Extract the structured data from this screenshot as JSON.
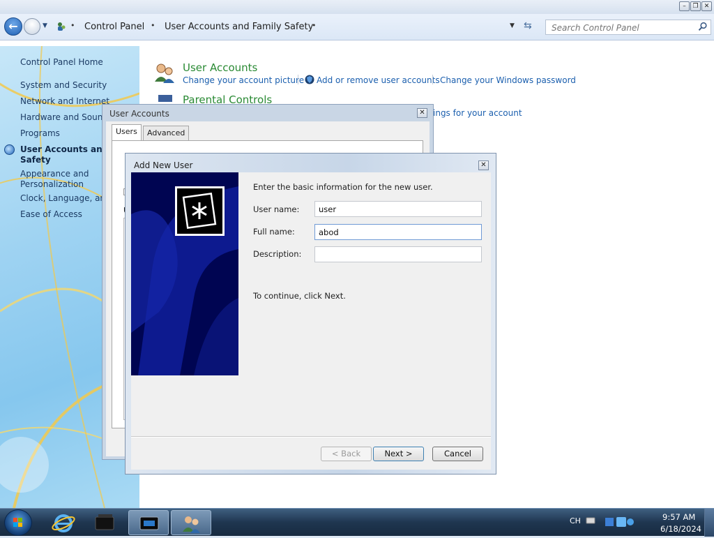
{
  "explorer": {
    "breadcrumbs": [
      "Control Panel",
      "User Accounts and Family Safety"
    ],
    "search_placeholder": "Search Control Panel"
  },
  "sidebar": {
    "home": "Control Panel Home",
    "items": [
      "System and Security",
      "Network and Internet",
      "Hardware and Sound",
      "Programs"
    ],
    "current_line1": "User Accounts and Fa",
    "current_line2": "Safety",
    "items_after": [
      "Appearance and",
      "Personalization",
      "Clock, Language, and",
      "Ease of Access"
    ]
  },
  "main": {
    "user_accounts": {
      "title": "User Accounts",
      "links": [
        "Change your account picture",
        "Add or remove user accounts",
        "Change your Windows password"
      ]
    },
    "parental_controls": {
      "title": "Parental Controls",
      "link_tail": "ings for your account"
    }
  },
  "ua_dialog": {
    "title": "User Accounts",
    "tabs": [
      "Users",
      "Advanced"
    ],
    "partial_label": "U"
  },
  "add_user_dialog": {
    "title": "Add New User",
    "intro": "Enter the basic information for the new user.",
    "fields": {
      "username_label": "User name:",
      "username_value": "user",
      "fullname_label": "Full name:",
      "fullname_value": "abod",
      "description_label": "Description:",
      "description_value": ""
    },
    "continue_text": "To continue, click Next.",
    "buttons": {
      "back": "< Back",
      "next": "Next >",
      "cancel": "Cancel"
    },
    "banner_color": "#000552"
  },
  "taskbar": {
    "language": "CH",
    "time": "9:57 AM",
    "date": "6/18/2024",
    "pinned": [
      "internet-explorer-icon",
      "media-icon",
      "remote-desktop-icon",
      "user-accounts-icon"
    ]
  }
}
